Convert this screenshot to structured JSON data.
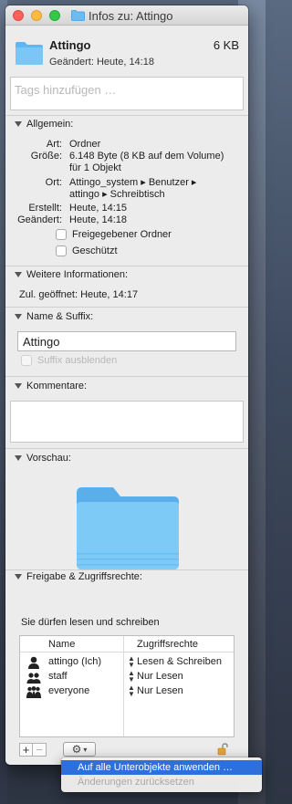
{
  "window": {
    "title": "Infos zu: Attingo"
  },
  "header": {
    "name": "Attingo",
    "size": "6 KB",
    "modified": "Geändert: Heute, 14:18"
  },
  "tags": {
    "placeholder": "Tags hinzufügen …"
  },
  "general": {
    "title": "Allgemein:",
    "rows": [
      {
        "label": "Art:",
        "value": "Ordner"
      },
      {
        "label": "Größe:",
        "value": "6.148 Byte (8 KB auf dem Volume)"
      },
      {
        "label": "",
        "value": "für 1 Objekt"
      },
      {
        "label": "Ort:",
        "value": "Attingo_system ▸ Benutzer ▸"
      },
      {
        "label": "",
        "value": "attingo ▸ Schreibtisch"
      },
      {
        "label": "Erstellt:",
        "value": "Heute, 14:15"
      },
      {
        "label": "Geändert:",
        "value": "Heute, 14:18"
      }
    ],
    "shared_folder": "Freigegebener Ordner",
    "locked": "Geschützt"
  },
  "more_info": {
    "title": "Weitere Informationen:",
    "last_opened": "Zul. geöffnet: Heute, 14:17"
  },
  "name_ext": {
    "title": "Name & Suffix:",
    "value": "Attingo",
    "hide_ext": "Suffix ausblenden"
  },
  "comments": {
    "title": "Kommentare:"
  },
  "preview": {
    "title": "Vorschau:"
  },
  "sharing": {
    "title": "Freigabe & Zugriffsrechte:",
    "info": "Sie dürfen lesen und schreiben",
    "col_name": "Name",
    "col_perm": "Zugriffsrechte",
    "rows": [
      {
        "name": "attingo (Ich)",
        "perm": "Lesen & Schreiben",
        "icon": "user-icon"
      },
      {
        "name": "staff",
        "perm": "Nur Lesen",
        "icon": "group-icon"
      },
      {
        "name": "everyone",
        "perm": "Nur Lesen",
        "icon": "everyone-icon"
      }
    ]
  },
  "buttons": {
    "add": "+",
    "remove": "−"
  },
  "action_menu": {
    "items": [
      {
        "label": "Auf alle Unterobjekte anwenden …",
        "state": "highlighted"
      },
      {
        "label": "Änderungen zurücksetzen",
        "state": "disabled"
      }
    ]
  },
  "colors": {
    "folder": "#5fb6f2",
    "menu_highlight": "#2d6fdb",
    "close": "#fc605c",
    "minimize": "#fdbc40",
    "zoom": "#34c84a"
  }
}
